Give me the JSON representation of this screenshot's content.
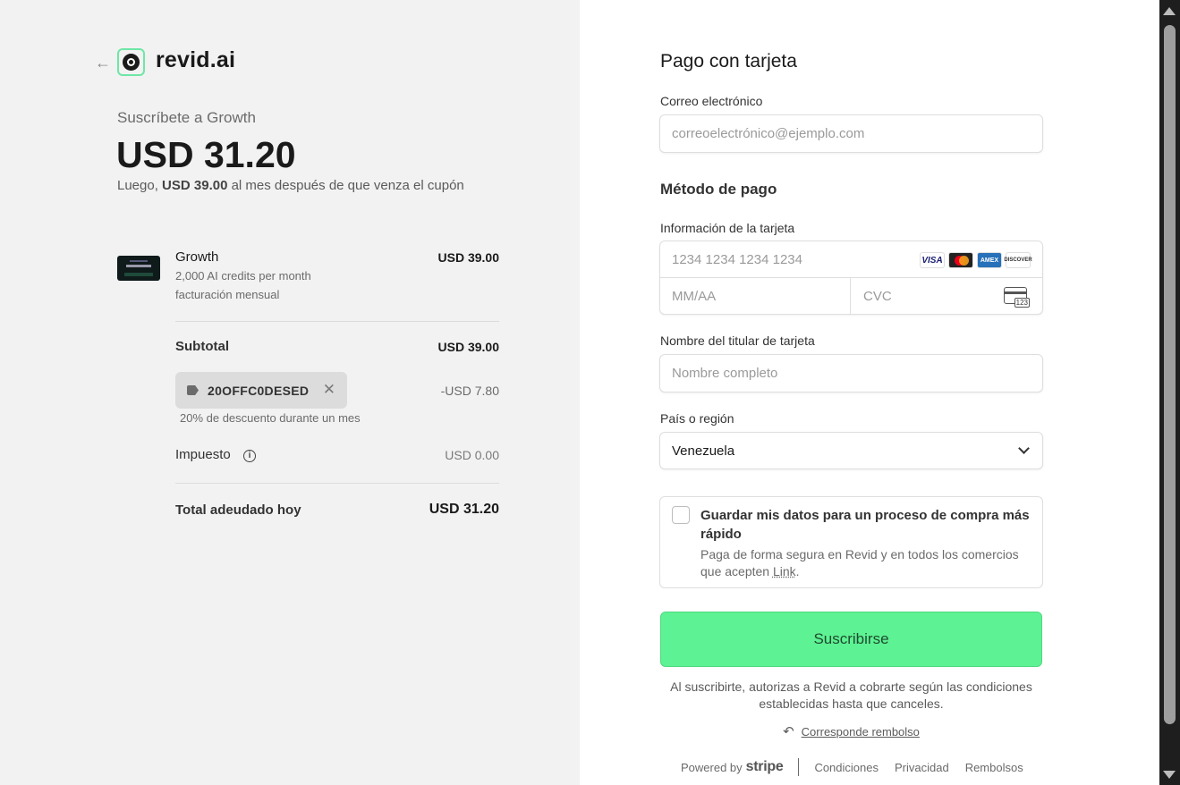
{
  "brand": {
    "name": "revid.ai"
  },
  "summary": {
    "subscribe_label": "Suscríbete a Growth",
    "price": "USD 31.20",
    "after_prefix": "Luego, ",
    "after_amount": "USD 39.00",
    "after_suffix": " al mes después de que venza el cupón"
  },
  "product": {
    "name": "Growth",
    "desc1": "2,000 AI credits per month",
    "desc2": "facturación mensual",
    "price": "USD 39.00"
  },
  "subtotal": {
    "label": "Subtotal",
    "value": "USD 39.00"
  },
  "coupon": {
    "code": "20OFFC0DESED",
    "close": "✕",
    "value": "-USD 7.80",
    "note": "20% de descuento durante un mes"
  },
  "tax": {
    "label": "Impuesto",
    "info": "i",
    "value": "USD 0.00"
  },
  "total": {
    "label": "Total adeudado hoy",
    "value": "USD 31.20"
  },
  "form": {
    "title": "Pago con tarjeta",
    "email_label": "Correo electrónico",
    "email_placeholder": "correoelectrónico@ejemplo.com",
    "method_title": "Método de pago",
    "card_label": "Información de la tarjeta",
    "card_number_placeholder": "1234 1234 1234 1234",
    "exp_placeholder": "MM/AA",
    "cvc_placeholder": "CVC",
    "cvc_icon_text": "123",
    "brands": {
      "visa": "VISA",
      "amex": "AMEX",
      "discover": "DISCOVER"
    },
    "name_label": "Nombre del titular de tarjeta",
    "name_placeholder": "Nombre completo",
    "country_label": "País o región",
    "country_value": "Venezuela",
    "save_title": "Guardar mis datos para un proceso de compra más rápido",
    "save_desc_prefix": "Paga de forma segura en Revid y en todos los comercios que acepten ",
    "save_link": "Link",
    "save_desc_suffix": ".",
    "submit": "Suscribirse",
    "legal": "Al suscribirte, autorizas a Revid a cobrarte según las condiciones establecidas hasta que canceles.",
    "refund_icon": "↶",
    "refund": "Corresponde rembolso"
  },
  "footer": {
    "powered_by": "Powered by",
    "stripe": "stripe",
    "links": [
      "Condiciones",
      "Privacidad",
      "Rembolsos"
    ]
  },
  "colors": {
    "submit_bg": "#5df293",
    "left_bg": "#f2f2f2",
    "logo_accent": "#6ee7a6"
  },
  "icons": [
    "back-arrow-icon",
    "logo-icon",
    "tag-icon",
    "close-icon",
    "info-icon",
    "visa-icon",
    "mastercard-icon",
    "amex-icon",
    "discover-icon",
    "cvc-card-icon",
    "chevron-down-icon",
    "undo-icon"
  ]
}
